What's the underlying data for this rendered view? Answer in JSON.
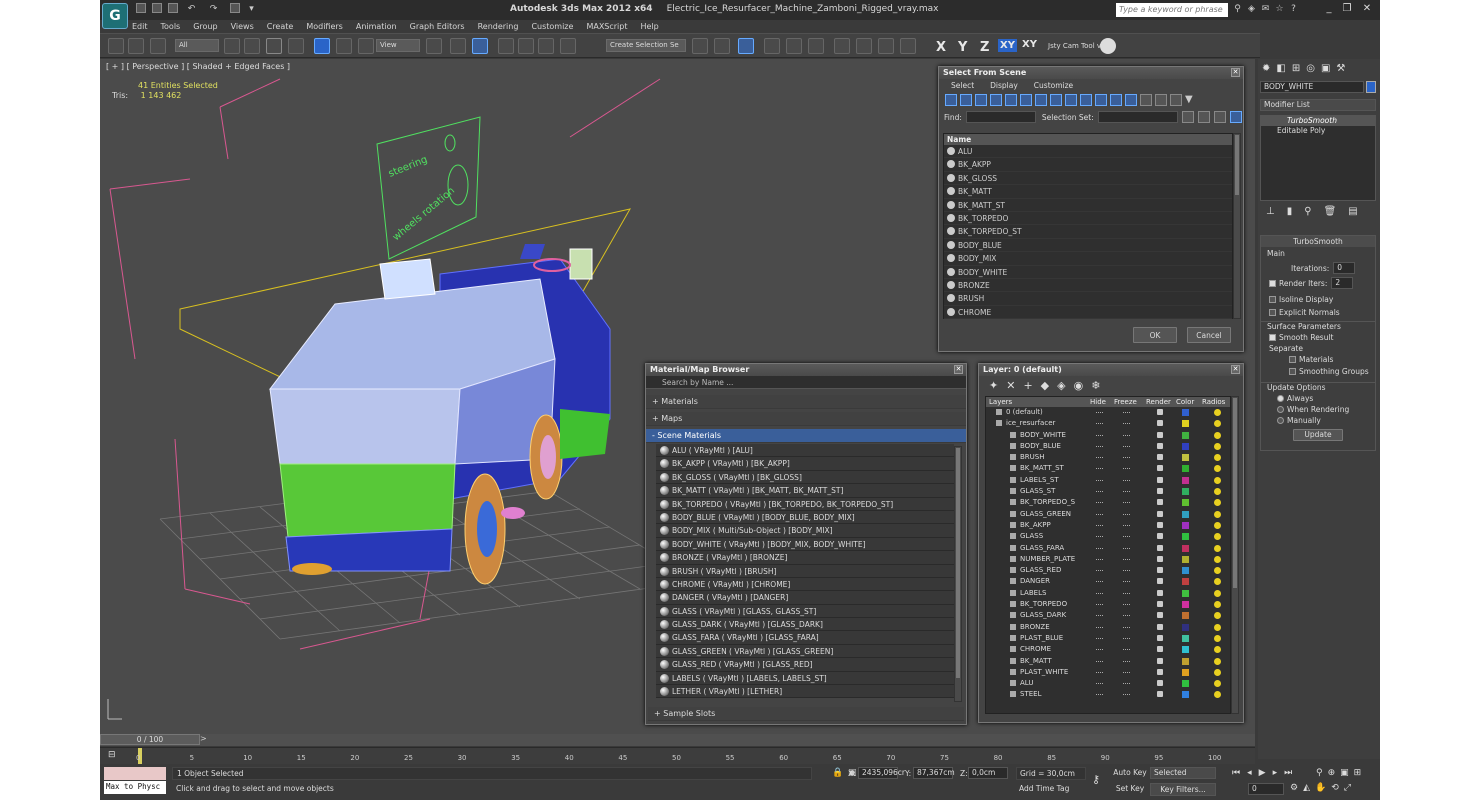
{
  "window": {
    "app_title": "Autodesk 3ds Max  2012 x64",
    "file_title": "Electric_Ice_Resurfacer_Machine_Zamboni_Rigged_vray.max",
    "search_placeholder": "Type a keyword or phrase"
  },
  "menu": [
    "Edit",
    "Tools",
    "Group",
    "Views",
    "Create",
    "Modifiers",
    "Animation",
    "Graph Editors",
    "Rendering",
    "Customize",
    "MAXScript",
    "Help"
  ],
  "toolbar": {
    "selection_filter": "All",
    "ref_coord": "View",
    "named_selection": "Create Selection Se",
    "axis_x": "X",
    "axis_y": "Y",
    "axis_z": "Z",
    "axis_xy": "XY",
    "axis_xy2": "XY",
    "cam_tool": "Jsty Cam Tool v"
  },
  "viewport": {
    "label": "[ + ] [ Perspective ] [ Shaded + Edged Faces ]",
    "selected": "41 Entities Selected",
    "tris_label": "Tris:",
    "tris_value": "1 143 462",
    "text_steering": "steering",
    "text_wheels": "wheels rotation"
  },
  "select_from_scene": {
    "title": "Select From Scene",
    "menu": [
      "Select",
      "Display",
      "Customize"
    ],
    "find_label": "Find:",
    "selection_set_label": "Selection Set:",
    "column_name": "Name",
    "items": [
      "ALU",
      "BK_AKPP",
      "BK_GLOSS",
      "BK_MATT",
      "BK_MATT_ST",
      "BK_TORPEDO",
      "BK_TORPEDO_ST",
      "BODY_BLUE",
      "BODY_MIX",
      "BODY_WHITE",
      "BRONZE",
      "BRUSH",
      "CHROME"
    ],
    "ok": "OK",
    "cancel": "Cancel"
  },
  "material_browser": {
    "title": "Material/Map Browser",
    "search": "Search by Name ...",
    "sections": {
      "materials": "+ Materials",
      "maps": "+ Maps",
      "scene": "- Scene Materials",
      "sample": "+ Sample Slots"
    },
    "items": [
      "ALU  ( VRayMtl ) [ALU]",
      "BK_AKPP  ( VRayMtl ) [BK_AKPP]",
      "BK_GLOSS  ( VRayMtl ) [BK_GLOSS]",
      "BK_MATT  ( VRayMtl ) [BK_MATT, BK_MATT_ST]",
      "BK_TORPEDO  ( VRayMtl ) [BK_TORPEDO, BK_TORPEDO_ST]",
      "BODY_BLUE  ( VRayMtl ) [BODY_BLUE, BODY_MIX]",
      "BODY_MIX  ( Multi/Sub-Object ) [BODY_MIX]",
      "BODY_WHITE  ( VRayMtl ) [BODY_MIX, BODY_WHITE]",
      "BRONZE  ( VRayMtl ) [BRONZE]",
      "BRUSH  ( VRayMtl ) [BRUSH]",
      "CHROME  ( VRayMtl ) [CHROME]",
      "DANGER  ( VRayMtl ) [DANGER]",
      "GLASS  ( VRayMtl ) [GLASS, GLASS_ST]",
      "GLASS_DARK  ( VRayMtl ) [GLASS_DARK]",
      "GLASS_FARA  ( VRayMtl ) [GLASS_FARA]",
      "GLASS_GREEN  ( VRayMtl ) [GLASS_GREEN]",
      "GLASS_RED  ( VRayMtl ) [GLASS_RED]",
      "LABELS  ( VRayMtl ) [LABELS, LABELS_ST]",
      "LETHER  ( VRayMtl ) [LETHER]"
    ]
  },
  "layer_dialog": {
    "title": "Layer: 0 (default)",
    "columns": [
      "Layers",
      "Hide",
      "Freeze",
      "Render",
      "Color",
      "Radios"
    ],
    "layers": [
      {
        "name": "0 (default)",
        "color": "#3060d0",
        "indent": 1
      },
      {
        "name": "ice_resurfacer",
        "color": "#e0d020",
        "indent": 1
      },
      {
        "name": "BODY_WHITE",
        "color": "#40b040",
        "indent": 2
      },
      {
        "name": "BODY_BLUE",
        "color": "#3040c0",
        "indent": 2
      },
      {
        "name": "BRUSH",
        "color": "#c0c040",
        "indent": 2
      },
      {
        "name": "BK_MATT_ST",
        "color": "#30b030",
        "indent": 2
      },
      {
        "name": "LABELS_ST",
        "color": "#c03090",
        "indent": 2
      },
      {
        "name": "GLASS_ST",
        "color": "#30b060",
        "indent": 2
      },
      {
        "name": "BK_TORPEDO_S",
        "color": "#60c030",
        "indent": 2
      },
      {
        "name": "GLASS_GREEN",
        "color": "#30a0c0",
        "indent": 2
      },
      {
        "name": "BK_AKPP",
        "color": "#a030c0",
        "indent": 2
      },
      {
        "name": "GLASS",
        "color": "#30c040",
        "indent": 2
      },
      {
        "name": "GLASS_FARA",
        "color": "#c03060",
        "indent": 2
      },
      {
        "name": "NUMBER_PLATE",
        "color": "#b0b030",
        "indent": 2
      },
      {
        "name": "GLASS_RED",
        "color": "#3090d0",
        "indent": 2
      },
      {
        "name": "DANGER",
        "color": "#c04040",
        "indent": 2
      },
      {
        "name": "LABELS",
        "color": "#40c040",
        "indent": 2
      },
      {
        "name": "BK_TORPEDO",
        "color": "#d030a0",
        "indent": 2
      },
      {
        "name": "GLASS_DARK",
        "color": "#c07030",
        "indent": 2
      },
      {
        "name": "BRONZE",
        "color": "#303080",
        "indent": 2
      },
      {
        "name": "PLAST_BLUE",
        "color": "#40c0a0",
        "indent": 2
      },
      {
        "name": "CHROME",
        "color": "#30c0d0",
        "indent": 2
      },
      {
        "name": "BK_MATT",
        "color": "#c0a030",
        "indent": 2
      },
      {
        "name": "PLAST_WHITE",
        "color": "#e0a020",
        "indent": 2
      },
      {
        "name": "ALU",
        "color": "#30c040",
        "indent": 2
      },
      {
        "name": "STEEL",
        "color": "#3080e0",
        "indent": 2
      }
    ]
  },
  "command_panel": {
    "object_name": "BODY_WHITE",
    "modifier_list": "Modifier List",
    "stack": [
      "TurboSmooth",
      "Editable Poly"
    ],
    "rollout_title": "TurboSmooth",
    "main": "Main",
    "iterations_label": "Iterations:",
    "iterations_value": "0",
    "render_iters_label": "Render Iters:",
    "render_iters_value": "2",
    "isoline": "Isoline Display",
    "explicit": "Explicit Normals",
    "surface_params": "Surface Parameters",
    "smooth_result": "Smooth Result",
    "separate": "Separate",
    "materials": "Materials",
    "smoothing_groups": "Smoothing Groups",
    "update_options": "Update Options",
    "always": "Always",
    "when_rendering": "When Rendering",
    "manually": "Manually",
    "update_btn": "Update"
  },
  "timeline": {
    "frame": "0 / 100",
    "ticks": [
      "0",
      "5",
      "10",
      "15",
      "20",
      "25",
      "30",
      "35",
      "40",
      "45",
      "50",
      "55",
      "60",
      "65",
      "70",
      "75",
      "80",
      "85",
      "90",
      "95",
      "100"
    ]
  },
  "status": {
    "maxscript": "Max to Physc",
    "selected": "1 Object Selected",
    "prompt": "Click and drag to select and move objects",
    "x_label": "X:",
    "x_value": "2435,096cr",
    "y_label": "Y:",
    "y_value": "87,367cm",
    "z_label": "Z:",
    "z_value": "0,0cm",
    "grid": "Grid = 30,0cm",
    "add_time_tag": "Add Time Tag",
    "auto_key": "Auto Key",
    "set_key": "Set Key",
    "selected_dd": "Selected",
    "key_filters": "Key Filters...",
    "frame_field": "0"
  },
  "colors": {
    "accent": "#3a5f9a",
    "selection_blue": "#2a64c8",
    "yellow_text": "#e0e060"
  }
}
